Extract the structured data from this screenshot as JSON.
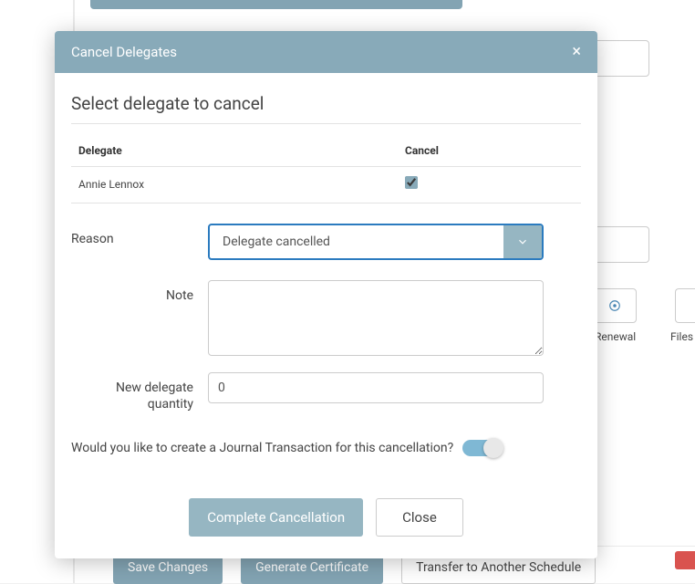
{
  "modal": {
    "title": "Cancel Delegates",
    "section_title": "Select delegate to cancel",
    "table": {
      "col_delegate": "Delegate",
      "col_cancel": "Cancel",
      "rows": [
        {
          "name": "Annie Lennox",
          "checked": true
        }
      ]
    },
    "reason": {
      "label": "Reason",
      "selected": "Delegate cancelled"
    },
    "note": {
      "label": "Note",
      "value": ""
    },
    "qty": {
      "label": "New delegate quantity",
      "value": "0"
    },
    "journal_prompt": "Would you like to create a Journal Transaction for this cancellation?",
    "journal_toggle": true,
    "actions": {
      "complete": "Complete Cancellation",
      "close": "Close"
    }
  },
  "background": {
    "renewal_label": "Renewal",
    "files_label": "Files",
    "buttons": {
      "save": "Save Changes",
      "generate": "Generate Certificate",
      "transfer": "Transfer to Another Schedule"
    }
  }
}
